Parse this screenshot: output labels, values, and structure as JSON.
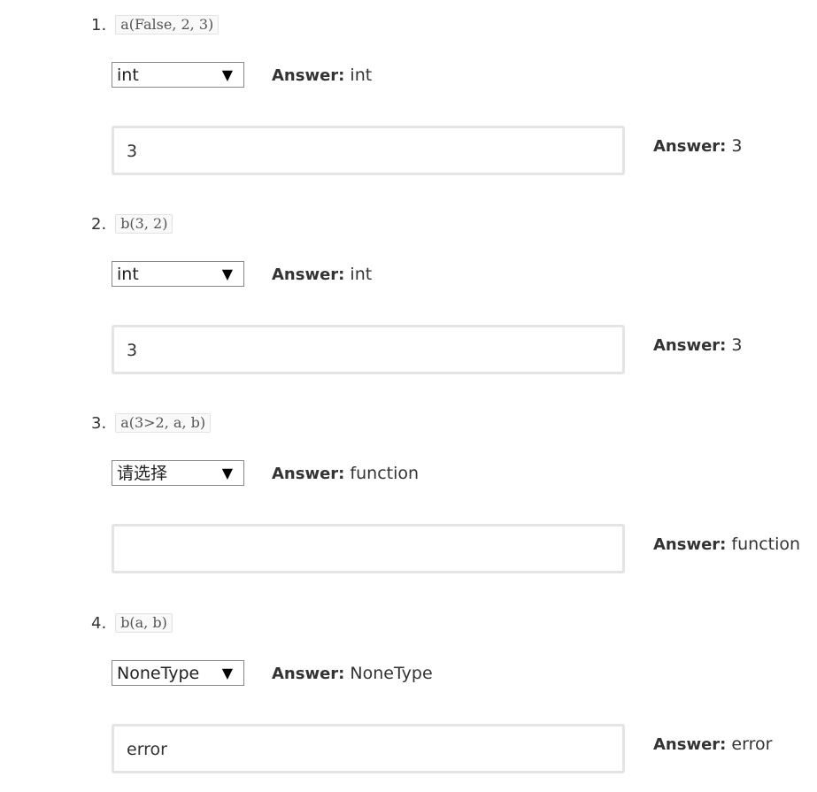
{
  "answer_label": "Answer:",
  "questions": [
    {
      "number": "1.",
      "code": "a(False, 2, 3)",
      "select_value": "int",
      "select_answer": "int",
      "text_value": "3",
      "text_answer": "3"
    },
    {
      "number": "2.",
      "code": "b(3, 2)",
      "select_value": "int",
      "select_answer": "int",
      "text_value": "3",
      "text_answer": "3"
    },
    {
      "number": "3.",
      "code": "a(3>2, a, b)",
      "select_value": "请选择",
      "select_answer": "function",
      "text_value": "",
      "text_answer": "function"
    },
    {
      "number": "4.",
      "code": "b(a, b)",
      "select_value": "NoneType",
      "select_answer": "NoneType",
      "text_value": "error",
      "text_answer": "error"
    }
  ],
  "icons": {
    "dropdown_arrow": "▼"
  }
}
